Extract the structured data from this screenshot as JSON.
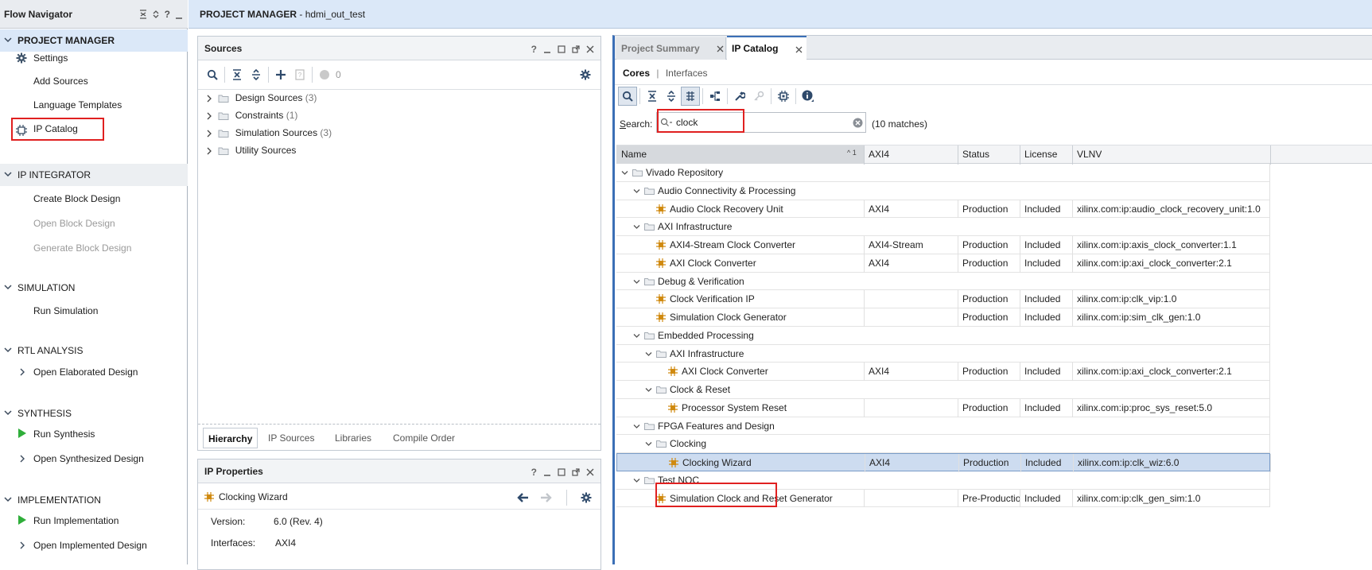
{
  "flow_navigator": {
    "title": "Flow Navigator",
    "sections": [
      {
        "label": "PROJECT MANAGER",
        "items": [
          "Settings",
          "Add Sources",
          "Language Templates",
          "IP Catalog"
        ]
      },
      {
        "label": "IP INTEGRATOR",
        "items": [
          "Create Block Design",
          "Open Block Design",
          "Generate Block Design"
        ]
      },
      {
        "label": "SIMULATION",
        "items": [
          "Run Simulation"
        ]
      },
      {
        "label": "RTL ANALYSIS",
        "items": [
          "Open Elaborated Design"
        ]
      },
      {
        "label": "SYNTHESIS",
        "items": [
          "Run Synthesis",
          "Open Synthesized Design"
        ]
      },
      {
        "label": "IMPLEMENTATION",
        "items": [
          "Run Implementation",
          "Open Implemented Design"
        ]
      }
    ]
  },
  "main_title": {
    "prefix": "PROJECT MANAGER",
    "sep": " - ",
    "project": "hdmi_out_test"
  },
  "sources": {
    "title": "Sources",
    "help": "?",
    "status_count": "0",
    "tree": [
      {
        "label": "Design Sources",
        "count": "(3)"
      },
      {
        "label": "Constraints",
        "count": "(1)"
      },
      {
        "label": "Simulation Sources",
        "count": "(3)"
      },
      {
        "label": "Utility Sources",
        "count": ""
      }
    ],
    "tabs": [
      "Hierarchy",
      "IP Sources",
      "Libraries",
      "Compile Order"
    ]
  },
  "ip_properties": {
    "title": "IP Properties",
    "help": "?",
    "selected": "Clocking Wizard",
    "props": [
      {
        "key": "Version:",
        "value": "6.0 (Rev. 4)"
      },
      {
        "key": "Interfaces:",
        "value": "AXI4"
      }
    ]
  },
  "ip_catalog": {
    "tabs": [
      "Project Summary",
      "IP Catalog"
    ],
    "subtabs": [
      "Cores",
      "|",
      "Interfaces"
    ],
    "search_label_prefix": "S",
    "search_label_rest": "earch:",
    "search_value": "clock",
    "matches": "(10 matches)",
    "columns": [
      "Name",
      "AXI4",
      "Status",
      "License",
      "VLNV"
    ],
    "sort_indicator": "1",
    "rows": [
      {
        "type": "folder",
        "level": 0,
        "name": "Vivado Repository"
      },
      {
        "type": "folder",
        "level": 1,
        "name": "Audio Connectivity & Processing"
      },
      {
        "type": "ip",
        "level": 2,
        "name": "Audio Clock Recovery Unit",
        "axi4": "AXI4",
        "status": "Production",
        "license": "Included",
        "vlnv": "xilinx.com:ip:audio_clock_recovery_unit:1.0"
      },
      {
        "type": "folder",
        "level": 1,
        "name": "AXI Infrastructure"
      },
      {
        "type": "ip",
        "level": 2,
        "name": "AXI4-Stream Clock Converter",
        "axi4": "AXI4-Stream",
        "status": "Production",
        "license": "Included",
        "vlnv": "xilinx.com:ip:axis_clock_converter:1.1"
      },
      {
        "type": "ip",
        "level": 2,
        "name": "AXI Clock Converter",
        "axi4": "AXI4",
        "status": "Production",
        "license": "Included",
        "vlnv": "xilinx.com:ip:axi_clock_converter:2.1"
      },
      {
        "type": "folder",
        "level": 1,
        "name": "Debug & Verification"
      },
      {
        "type": "ip",
        "level": 2,
        "name": "Clock Verification IP",
        "axi4": "",
        "status": "Production",
        "license": "Included",
        "vlnv": "xilinx.com:ip:clk_vip:1.0"
      },
      {
        "type": "ip",
        "level": 2,
        "name": "Simulation Clock Generator",
        "axi4": "",
        "status": "Production",
        "license": "Included",
        "vlnv": "xilinx.com:ip:sim_clk_gen:1.0"
      },
      {
        "type": "folder",
        "level": 1,
        "name": "Embedded Processing"
      },
      {
        "type": "folder",
        "level": 2,
        "name": "AXI Infrastructure"
      },
      {
        "type": "ip",
        "level": 3,
        "name": "AXI Clock Converter",
        "axi4": "AXI4",
        "status": "Production",
        "license": "Included",
        "vlnv": "xilinx.com:ip:axi_clock_converter:2.1"
      },
      {
        "type": "folder",
        "level": 2,
        "name": "Clock & Reset"
      },
      {
        "type": "ip",
        "level": 3,
        "name": "Processor System Reset",
        "axi4": "",
        "status": "Production",
        "license": "Included",
        "vlnv": "xilinx.com:ip:proc_sys_reset:5.0"
      },
      {
        "type": "folder",
        "level": 1,
        "name": "FPGA Features and Design"
      },
      {
        "type": "folder",
        "level": 2,
        "name": "Clocking"
      },
      {
        "type": "ip",
        "level": 3,
        "name": "Clocking Wizard",
        "axi4": "AXI4",
        "status": "Production",
        "license": "Included",
        "vlnv": "xilinx.com:ip:clk_wiz:6.0",
        "selected": true
      },
      {
        "type": "folder",
        "level": 1,
        "name": "Test NOC"
      },
      {
        "type": "ip",
        "level": 2,
        "name": "Simulation Clock and Reset Generator",
        "axi4": "",
        "status": "Pre-Production",
        "license": "Included",
        "vlnv": "xilinx.com:ip:clk_gen_sim:1.0"
      }
    ]
  },
  "colors": {
    "highlight": "#e02020",
    "selected_row": "#cddcf0",
    "accent_blue": "#3b6fb6",
    "run_green": "#2fae3a",
    "ip_icon": "#d08a10"
  }
}
